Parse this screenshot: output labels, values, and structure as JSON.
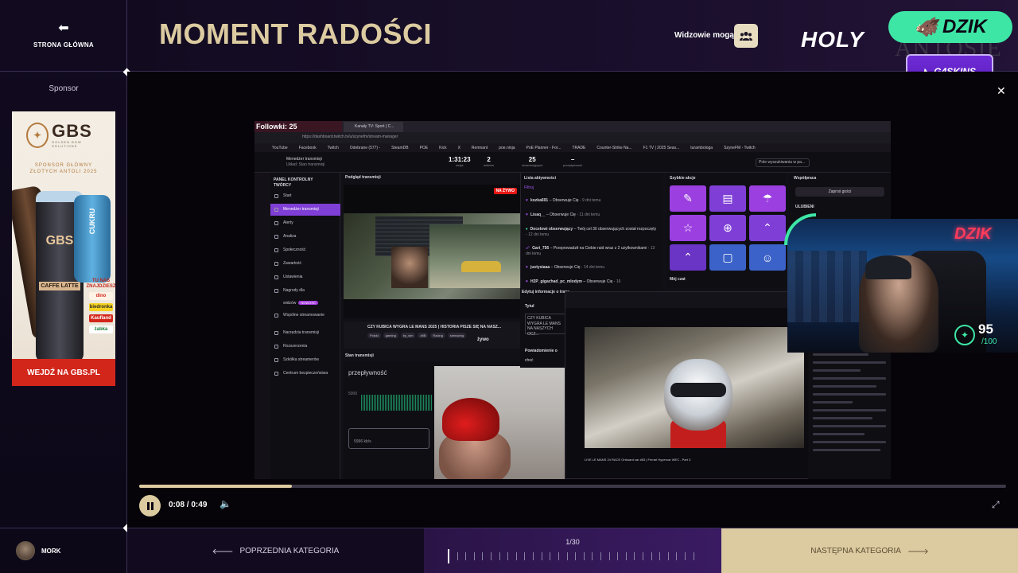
{
  "nav": {
    "home_label": "STRONA GŁÓWNA"
  },
  "sponsor": {
    "label": "Sponsor",
    "ad": {
      "brand": "GBS",
      "brand_sub": "GOLDEN BOW SOLUTIONS",
      "line1": "SPONSOR GŁÓWNY",
      "line2": "ZŁOTYCH ANTOLI 2025",
      "can_label": "CAFFE LATTE",
      "can_side": "CUKRU",
      "stores_title": "TU NAS ZNAJDZIESZ",
      "stores": [
        "dino",
        "biedronka",
        "Kaufland",
        "żabka"
      ],
      "cta": "WEJDŹ NA GBS.PL"
    }
  },
  "user": {
    "name": "MORK"
  },
  "header": {
    "title": "MOMENT RADOŚCI",
    "viewers_label": "Widzowie mogą",
    "brand_holy": "HOLY",
    "brand_antosie": "ANTOSIE",
    "brand_dzik": "DZIK",
    "brand_g4": "G4SKINS"
  },
  "video": {
    "elapsed": "0:08",
    "duration": "0:49",
    "progress_fraction": 0.176,
    "screen": {
      "followers_tab": "Followki: 25",
      "second_tab": "Kanały TV: Sport | C...",
      "url": "https://dashboard.twitch.tv/u/szynefm/stream-manager",
      "bookmarks": [
        "YouTube",
        "Facebook",
        "Twitch",
        "Odebrane (577) -",
        "SteamDB",
        "POE",
        "Kick",
        "X",
        "Remnant",
        "poe.ninja",
        "PoE Planner - For...",
        "TRADE",
        "Counter-Strike Na...",
        "F1 TV | 2025 Seas...",
        "turambologa",
        "SzyneFM - Twitch"
      ],
      "manager_title": "Menedżer transmisji",
      "manager_sub": "Układ: Stan transmisji",
      "stats": [
        {
          "value": "1:31:23",
          "label": "sesja"
        },
        {
          "value": "2",
          "label": "widzów"
        },
        {
          "value": "25",
          "label": "obserwujących"
        },
        {
          "value": "–",
          "label": "przepływność"
        }
      ],
      "search": "Pole wyszukiwania w pa...",
      "nav_header": "PANEL KONTROLNY TWÓRCY",
      "nav_items": [
        "Start",
        "Menedżer transmisji",
        "Alerty",
        "Analiza",
        "Społeczność",
        "Zawartość",
        "Ustawienia",
        "Nagrody dla widzów",
        "Wspólne streamowanie",
        "Narzędzia transmisji",
        "Rozszerzenia",
        "Szkółka streamerów",
        "Centrum bezpieczeństwa"
      ],
      "nav_new_tag": "NOWOŚĆ",
      "preview_header": "Podgląd transmisji",
      "live_badge": "NA ŻYWO",
      "stream_title": "CZY KUBICA WYGRA LE MANS 2025 | HISTORIA PISZE SIĘ NA NASZ...",
      "stream_tags": [
        "Polski",
        "gaming",
        "by_sim",
        "#tiB",
        "Racing",
        "simracing"
      ],
      "zywo": "żywo",
      "state_header": "Stan transmisji",
      "bitrate_label": "przepływność",
      "bitrate_axis": "5000",
      "bitrate_box": "5996 kb/s",
      "activity_header": "Lista aktywności",
      "activity_filter": "Filtruj",
      "activity": [
        {
          "user": "kozka691",
          "action": "Obserwuje Cię",
          "time": "9 dni temu"
        },
        {
          "user": "Lisaq__",
          "action": "Obserwuje Cię",
          "time": "11 dni temu"
        },
        {
          "user": "Docelowi obserwujący",
          "action": "Twój cel 30 obserwujących został rozpoczęty",
          "time": "12 dni temu"
        },
        {
          "user": "Gari_756",
          "action": "Przeprowadził na Ciebie raid wraz z 2 użytkownikami",
          "time": "13 dni temu"
        },
        {
          "user": "justysiaaa",
          "action": "Obserwuje Cię",
          "time": "14 dni temu"
        },
        {
          "user": "H2P_gigachad_pc_mlodym",
          "action": "Obserwuje Cię",
          "time": "16"
        }
      ],
      "quick_header": "Szybkie akcje",
      "chat_header": "Mój czat",
      "collab_header": "Współpraca",
      "collab_button": "Zaproś gości",
      "favorites": "ULUBIENI",
      "edit_header": "Edytuj informacje o transmisji",
      "edit_title_label": "Tytuł",
      "edit_title_value": "CZY KUBICA WYGRA LE MANS NA NASZYCH OCZ...",
      "notify_label": "Powiadomienie o",
      "notify_value": "choć",
      "video_title": "LIVE LE MANS 24 RACE Onboard car #83 | Ferrari Hypercar WEC - Part 3",
      "webcam_sign": "DZIK",
      "score_value": "95",
      "score_max": "/100"
    }
  },
  "bottom": {
    "prev_label": "POPRZEDNIA KATEGORIA",
    "counter": "1/30",
    "current_index": 1,
    "total": 30,
    "next_label": "NASTĘPNA KATEGORIA"
  },
  "colors": {
    "gold": "#dccba0",
    "accent_green": "#3ee6a6",
    "purple": "#7f3fd6",
    "background": "#0b0714"
  }
}
